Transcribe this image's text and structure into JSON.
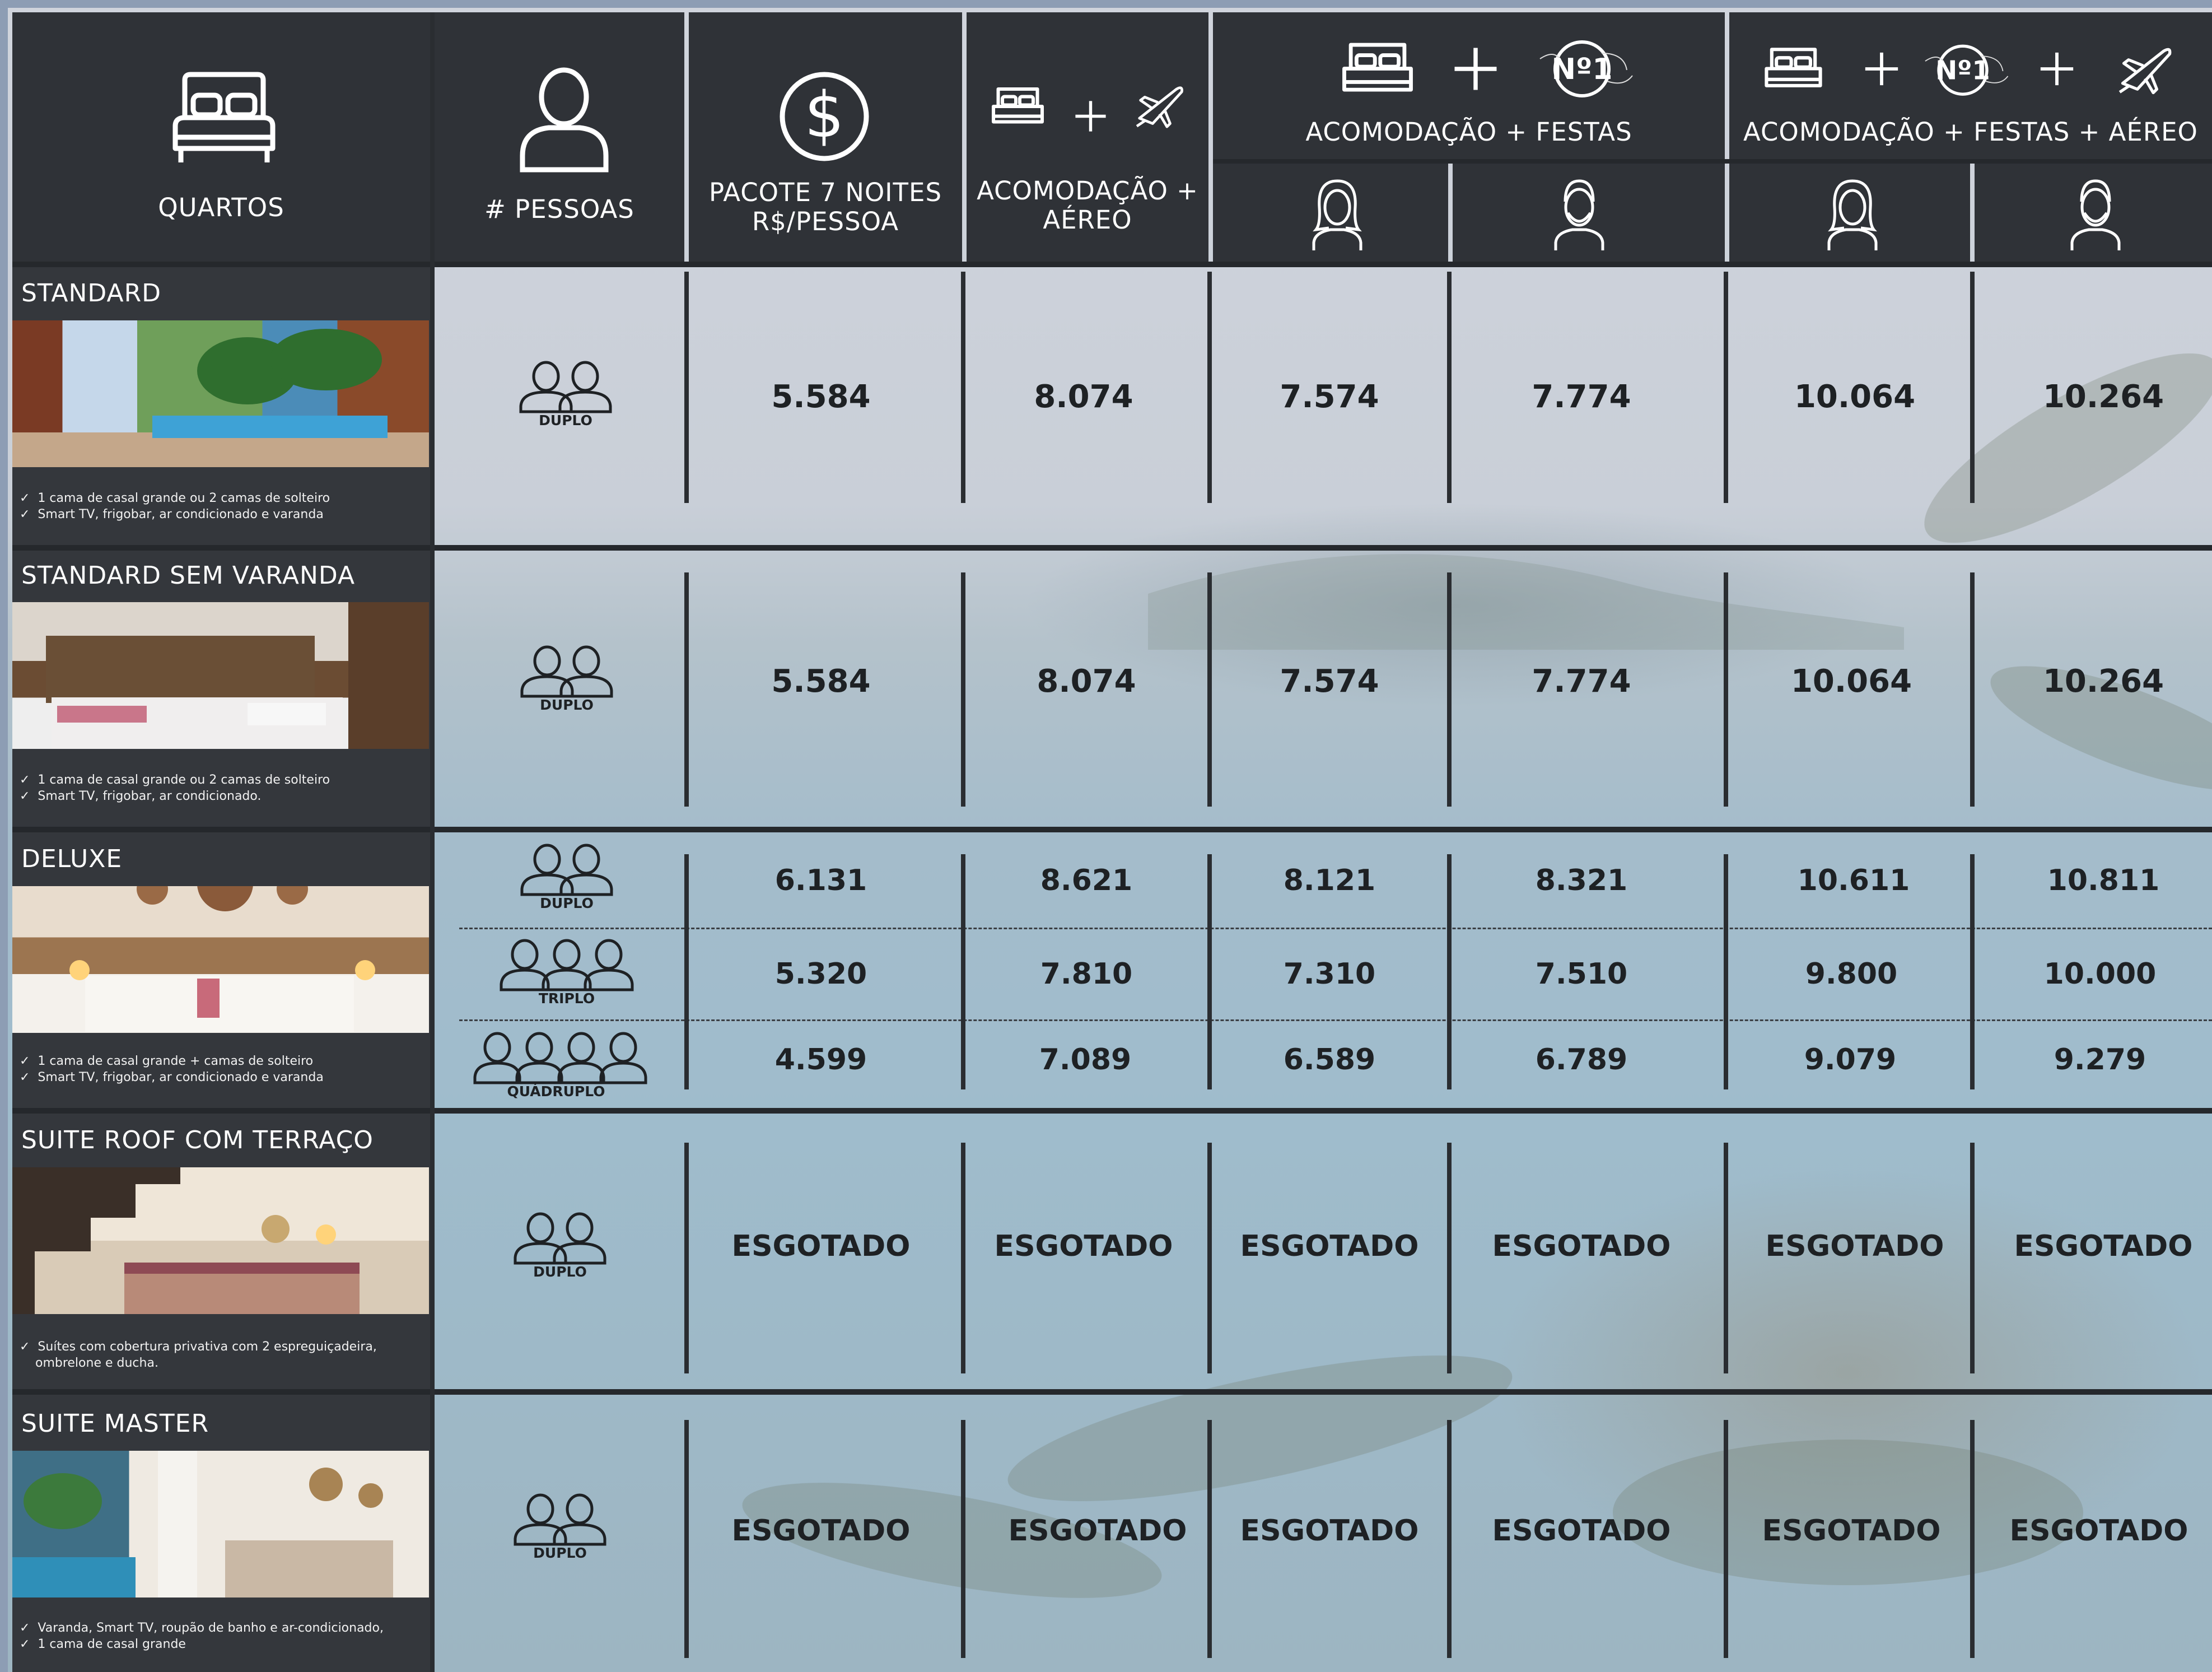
{
  "header": {
    "col_rooms": "QUARTOS",
    "col_people": "# PESSOAS",
    "col_package": "PACOTE 7 NOITES R$/PESSOA",
    "col_air": "ACOMODAÇÃO + AÉREO",
    "col_parties": "ACOMODAÇÃO + FESTAS",
    "col_parties_air": "ACOMODAÇÃO + FESTAS + AÉREO",
    "logo_text": "Nº1"
  },
  "rooms": [
    {
      "name": "STANDARD",
      "desc": [
        "1 cama de casal grande ou 2 camas de solteiro",
        "Smart TV, frigobar, ar condicionado e varanda"
      ],
      "rows": [
        {
          "occupancy": "DUPLO",
          "values": [
            "5.584",
            "8.074",
            "7.574",
            "7.774",
            "10.064",
            "10.264"
          ]
        }
      ]
    },
    {
      "name": "STANDARD SEM VARANDA",
      "desc": [
        "1 cama de casal grande ou 2 camas de solteiro",
        "Smart TV, frigobar, ar condicionado."
      ],
      "rows": [
        {
          "occupancy": "DUPLO",
          "values": [
            "5.584",
            "8.074",
            "7.574",
            "7.774",
            "10.064",
            "10.264"
          ]
        }
      ]
    },
    {
      "name": "DELUXE",
      "desc": [
        "1 cama de casal grande + camas de solteiro",
        "Smart TV, frigobar, ar condicionado e varanda"
      ],
      "rows": [
        {
          "occupancy": "DUPLO",
          "values": [
            "6.131",
            "8.621",
            "8.121",
            "8.321",
            "10.611",
            "10.811"
          ]
        },
        {
          "occupancy": "TRIPLO",
          "values": [
            "5.320",
            "7.810",
            "7.310",
            "7.510",
            "9.800",
            "10.000"
          ]
        },
        {
          "occupancy": "QUÁDRUPLO",
          "values": [
            "4.599",
            "7.089",
            "6.589",
            "6.789",
            "9.079",
            "9.279"
          ]
        }
      ]
    },
    {
      "name": "SUITE ROOF COM TERRAÇO",
      "desc": [
        "Suítes  com cobertura privativa com 2 espreguiçadeira,",
        "ombrelone e ducha."
      ],
      "rows": [
        {
          "occupancy": "DUPLO",
          "values": [
            "ESGOTADO",
            "ESGOTADO",
            "ESGOTADO",
            "ESGOTADO",
            "ESGOTADO",
            "ESGOTADO"
          ]
        }
      ]
    },
    {
      "name": "SUITE MASTER",
      "desc": [
        "Varanda, Smart TV, roupão de banho e ar-condicionado,",
        "1 cama de casal grande"
      ],
      "rows": [
        {
          "occupancy": "DUPLO",
          "values": [
            "ESGOTADO",
            "ESGOTADO",
            "ESGOTADO",
            "ESGOTADO",
            "ESGOTADO",
            "ESGOTADO"
          ]
        }
      ]
    }
  ],
  "icons": [
    "bed-icon",
    "person-icon",
    "dollar-icon",
    "plane-icon",
    "plus-icon",
    "woman-icon",
    "man-icon",
    "group-icon"
  ],
  "colors": {
    "header_bg": "#2f3237",
    "frame": "#8d9db4",
    "text_dark": "#1e2124"
  }
}
